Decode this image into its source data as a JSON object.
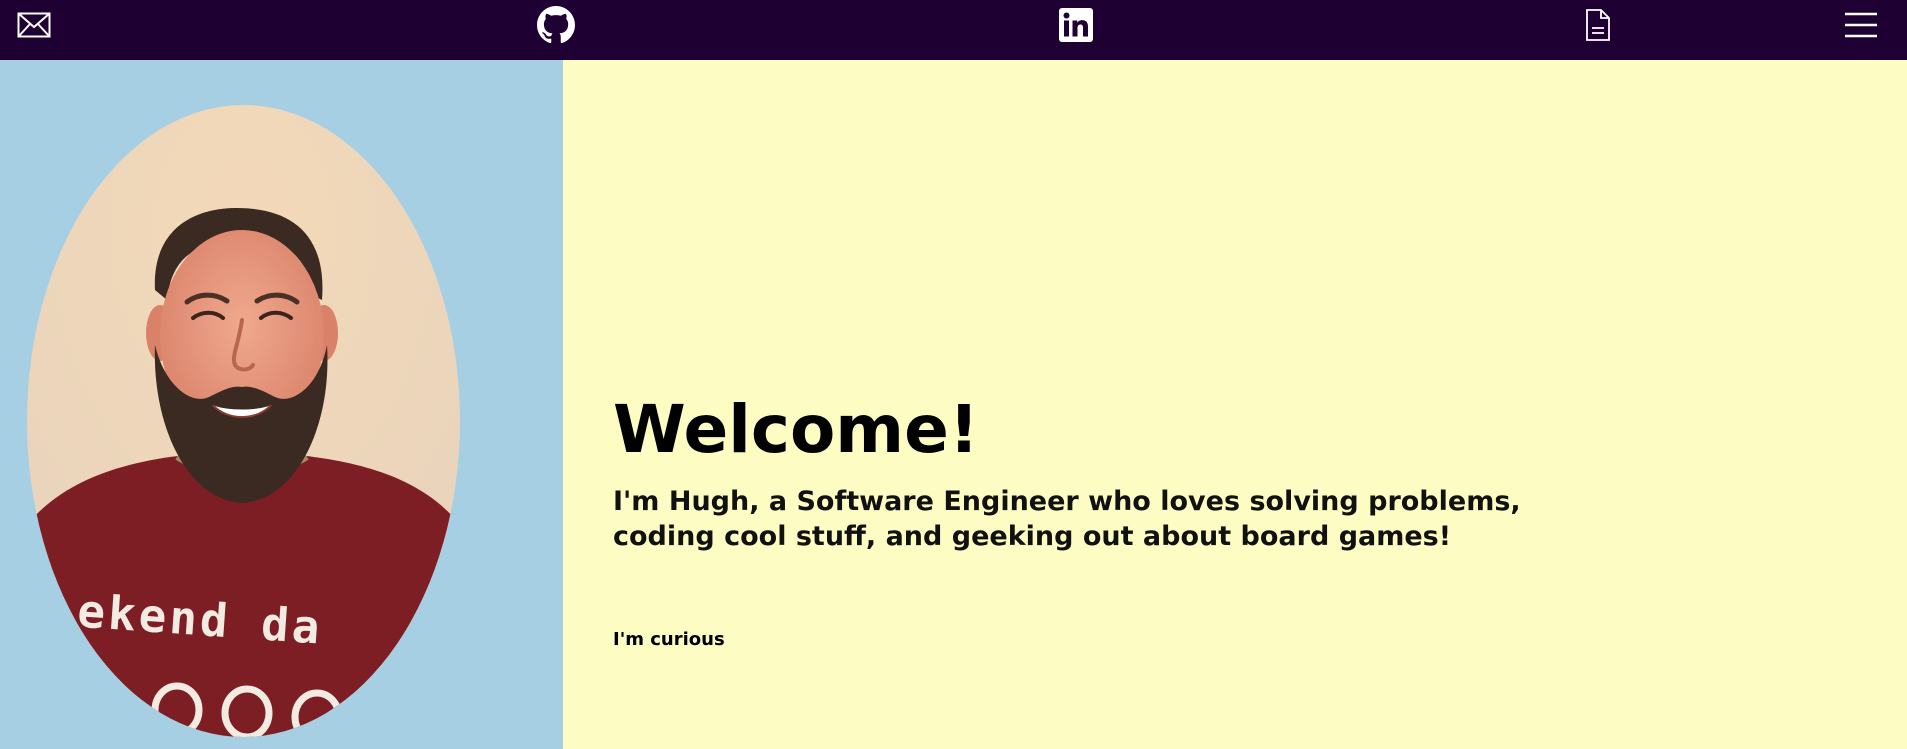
{
  "nav": {
    "icons": [
      "envelope-icon",
      "github-icon",
      "linkedin-icon",
      "document-icon",
      "hamburger-menu-icon"
    ]
  },
  "hero": {
    "heading": "Welcome!",
    "intro_line_1": "I'm Hugh, a Software Engineer who loves solving problems,",
    "intro_line_2": "coding cool stuff, and geeking out about board games!",
    "typed_text": "I'm curious"
  },
  "portrait": {
    "sweater_text": "ekend da"
  },
  "colors": {
    "topbar": "#1e0033",
    "left_panel": "#a6cfe4",
    "right_panel": "#fdfdc3",
    "text": "#000000"
  }
}
